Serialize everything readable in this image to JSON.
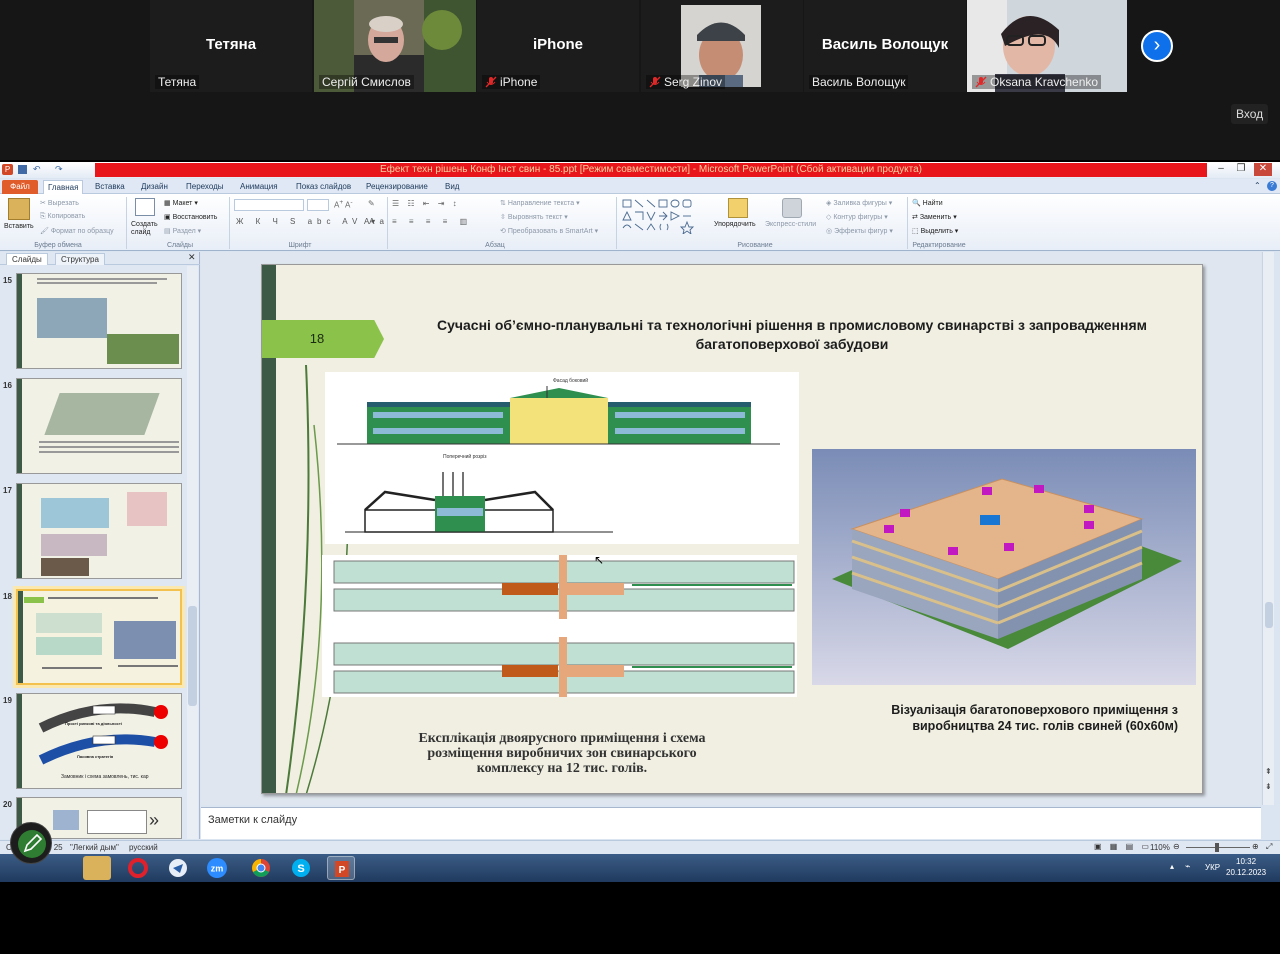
{
  "gallery": {
    "participants": [
      {
        "big": "Тетяна",
        "name": "Тетяна",
        "muted": false,
        "video": false
      },
      {
        "big": "",
        "name": "Сергій Смислов",
        "muted": false,
        "video": true,
        "active": true
      },
      {
        "big": "iPhone",
        "name": "iPhone",
        "muted": true,
        "video": false
      },
      {
        "big": "",
        "name": "Serg Zinov",
        "muted": true,
        "video": true
      },
      {
        "big": "Василь Волощук",
        "name": "Василь Волощук",
        "muted": false,
        "video": false
      },
      {
        "big": "",
        "name": "Oksana Kravchenko",
        "muted": true,
        "video": true
      }
    ],
    "enter_label": "Вход"
  },
  "ppt": {
    "title": "Ефект техн рішень Конф Інст свин - 85.ppt [Режим совместимости] - Microsoft PowerPoint (Сбой активации продукта)",
    "tabs": [
      "Файл",
      "Главная",
      "Вставка",
      "Дизайн",
      "Переходы",
      "Анимация",
      "Показ слайдов",
      "Рецензирование",
      "Вид"
    ],
    "ribbon": {
      "paste": "Вставить",
      "cut": "Вырезать",
      "copy": "Копировать",
      "format_painter": "Формат по образцу",
      "clipboard_group": "Буфер обмена",
      "new_slide": "Создать слайд",
      "layout": "Макет",
      "reset": "Восстановить",
      "section": "Раздел",
      "slides_group": "Слайды",
      "font_group": "Шрифт",
      "text_direction": "Направление текста",
      "align_text": "Выровнять текст",
      "smartart": "Преобразовать в SmartArt",
      "paragraph_group": "Абзац",
      "arrange": "Упорядочить",
      "quick_styles": "Экспресс-стили",
      "shape_fill": "Заливка фигуры",
      "shape_outline": "Контур фигуры",
      "shape_effects": "Эффекты фигур",
      "drawing_group": "Рисование",
      "find": "Найти",
      "replace": "Заменить",
      "select": "Выделить",
      "editing_group": "Редактирование"
    },
    "panel_tabs": [
      "Слайды",
      "Структура"
    ],
    "thumbnails": [
      {
        "num": "15",
        "caption": ""
      },
      {
        "num": "16",
        "caption": ""
      },
      {
        "num": "17",
        "caption": ""
      },
      {
        "num": "18",
        "caption": "",
        "selected": true
      },
      {
        "num": "19",
        "caption": "Замовник і схема замовлень, тис. кар"
      },
      {
        "num": "20",
        "caption": ""
      }
    ],
    "thumb19": {
      "t1": "Прості ринкові та діяльності",
      "t2": "Пасивна стратегія"
    },
    "slide": {
      "number": "18",
      "title": "Сучасні об’ємно-планувальні та технологічні рішення в промисловому свинарстві з запровадженням багатоповерхової забудови",
      "caption_right": "Візуалізація багатоповерхового приміщення з виробництва 24 тис. голів свиней (60х60м)",
      "caption_left": "Експлікація двоярусного приміщення і схема розміщення виробничих зон свинарського комплексу на 12 тис. голів.",
      "drawing_label1": "Фасад боковий",
      "drawing_label2": "Поперечний розріз"
    },
    "notes_placeholder": "Заметки к слайду",
    "status": {
      "slide": "Слайд 18 из 25",
      "theme": "\"Легкий дым\"",
      "language": "русский",
      "zoom": "110%"
    }
  },
  "taskbar": {
    "lang": "УКР",
    "time": "10:32",
    "date": "20.12.2023"
  },
  "colors": {
    "accent_green": "#8bc34a",
    "zoom_blue": "#0e71eb",
    "title_red": "#e8151b",
    "mute_red": "#e02828"
  }
}
